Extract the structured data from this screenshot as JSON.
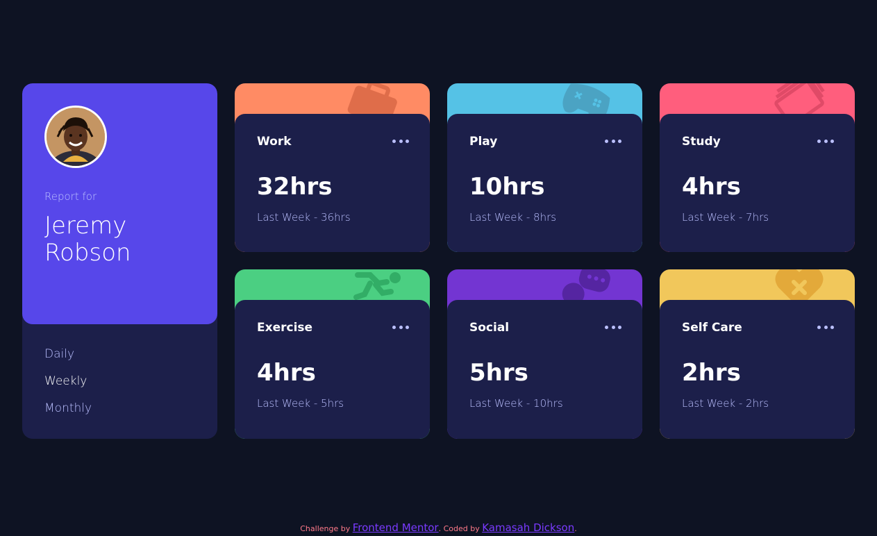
{
  "profile": {
    "report_for": "Report for",
    "name": "Jeremy Robson",
    "periods": [
      "Daily",
      "Weekly",
      "Monthly"
    ],
    "active_period": "Weekly"
  },
  "activities": [
    {
      "title": "Work",
      "current": "32hrs",
      "previous": "Last Week - 36hrs",
      "color": "#ff8b64",
      "icon": "briefcase-icon"
    },
    {
      "title": "Play",
      "current": "10hrs",
      "previous": "Last Week - 8hrs",
      "color": "#55c2e6",
      "icon": "gamepad-icon"
    },
    {
      "title": "Study",
      "current": "4hrs",
      "previous": "Last Week - 7hrs",
      "color": "#ff5e7d",
      "icon": "book-icon"
    },
    {
      "title": "Exercise",
      "current": "4hrs",
      "previous": "Last Week - 5hrs",
      "color": "#4bcf82",
      "icon": "running-icon"
    },
    {
      "title": "Social",
      "current": "5hrs",
      "previous": "Last Week - 10hrs",
      "color": "#7335d2",
      "icon": "speech-bubble-icon"
    },
    {
      "title": "Self Care",
      "current": "2hrs",
      "previous": "Last Week - 2hrs",
      "color": "#f1c75b",
      "icon": "heart-icon"
    }
  ],
  "footer": {
    "challenge_by": "Challenge by",
    "challenge_link": "Frontend Mentor",
    "coded_by": ". Coded by",
    "coder_link": "Kamasah Dickson",
    "end": "."
  },
  "colors": {
    "background": "#0e1323",
    "card": "#1c1f4a",
    "profile": "#5747ea",
    "muted_text": "#bbc0ff"
  }
}
